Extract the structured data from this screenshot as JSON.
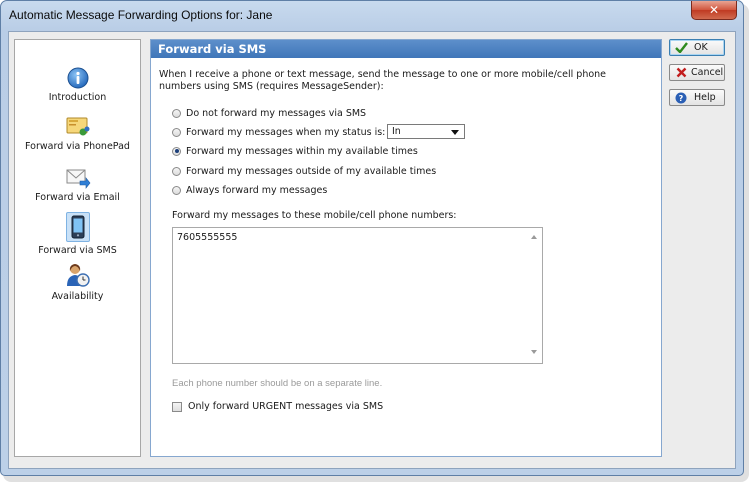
{
  "window": {
    "title": "Automatic Message Forwarding Options for: Jane",
    "close_icon": "close-icon"
  },
  "sidebar": {
    "items": [
      {
        "label": "Introduction",
        "icon": "info-icon"
      },
      {
        "label": "Forward via PhonePad",
        "icon": "phonepad-icon"
      },
      {
        "label": "Forward via Email",
        "icon": "email-icon"
      },
      {
        "label": "Forward via SMS",
        "icon": "mobile-phone-icon",
        "selected": true
      },
      {
        "label": "Availability",
        "icon": "availability-icon"
      }
    ]
  },
  "panel": {
    "header": "Forward via SMS",
    "description": "When I receive a phone or text message, send the message to one or more mobile/cell phone numbers using SMS (requires MessageSender):",
    "options": [
      {
        "label": "Do not forward my messages via SMS",
        "selected": false
      },
      {
        "label": "Forward my messages when my status is:",
        "selected": false
      },
      {
        "label": "Forward my messages within my available times",
        "selected": true
      },
      {
        "label": "Forward my messages outside of my available times",
        "selected": false
      },
      {
        "label": "Always forward my messages",
        "selected": false
      }
    ],
    "status_select_value": "In",
    "numbers_label": "Forward my messages to these mobile/cell phone numbers:",
    "numbers_value": "7605555555",
    "hint": "Each phone number should be on a separate line.",
    "urgent_checkbox_label": "Only forward URGENT messages via SMS",
    "urgent_checked": false
  },
  "buttons": {
    "ok": "OK",
    "cancel": "Cancel",
    "help": "Help"
  },
  "colors": {
    "header_blue": "#3f76b9",
    "title_bar": "#c8daee",
    "close_red": "#c03a22",
    "ok_check": "#2e8a1e",
    "cancel_x": "#c21d1d"
  }
}
